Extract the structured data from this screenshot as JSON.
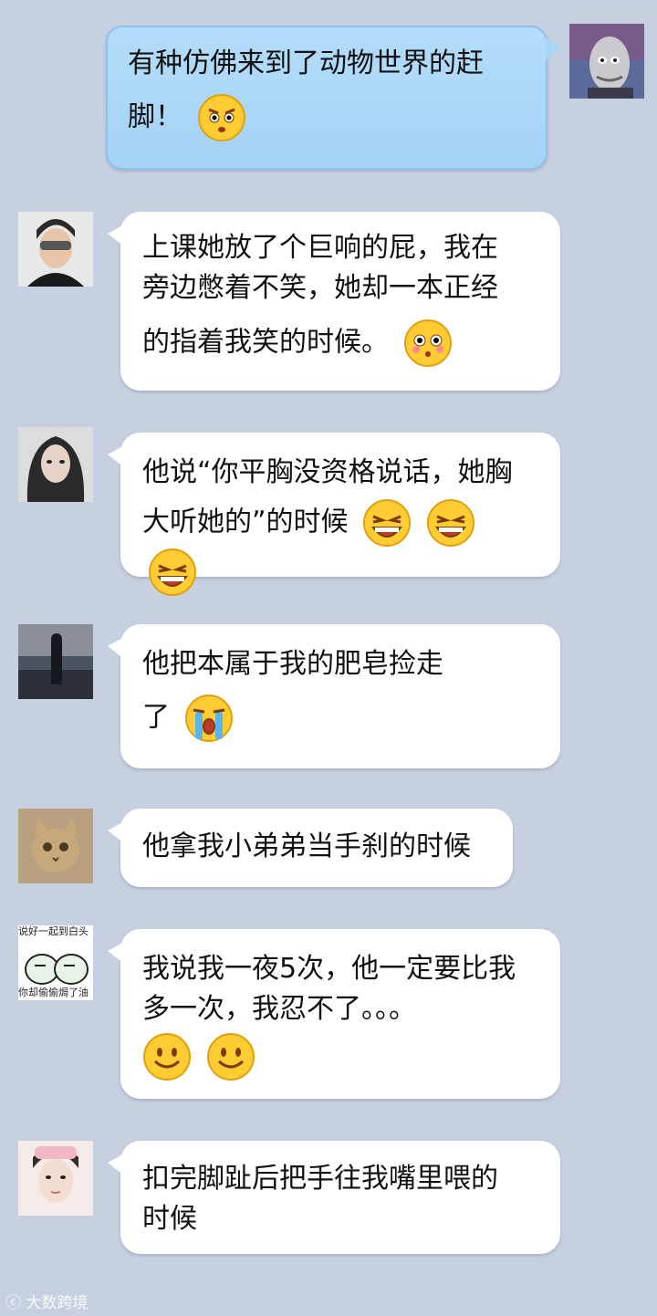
{
  "messages": [
    {
      "side": "out",
      "lines": [
        "有种仿佛来到了动物世界的赶",
        "脚！"
      ],
      "emoji": [
        "angry-face"
      ]
    },
    {
      "side": "in",
      "lines": [
        "上课她放了个巨响的屁，我在",
        "旁边憋着不笑，她却一本正经",
        "的指着我笑的时候。"
      ],
      "emoji": [
        "shocked-face"
      ]
    },
    {
      "side": "in",
      "lines": [
        "他说“你平胸没资格说话，她胸",
        "大听她的”的时候"
      ],
      "emoji": [
        "laughing-face",
        "laughing-face",
        "laughing-face"
      ]
    },
    {
      "side": "in",
      "lines": [
        "他把本属于我的肥皂捡走",
        "了"
      ],
      "emoji": [
        "crying-face"
      ]
    },
    {
      "side": "in",
      "lines": [
        "他拿我小弟弟当手刹的时候"
      ],
      "emoji": []
    },
    {
      "side": "in",
      "lines": [
        "我说我一夜5次，他一定要比我",
        "多一次，我忍不了。。。"
      ],
      "emoji": [
        "smile-face",
        "smile-face"
      ]
    },
    {
      "side": "in",
      "lines": [
        "扣完脚趾后把手往我嘴里喂的",
        "时候"
      ],
      "emoji": []
    }
  ],
  "avatar_texts": {
    "top": "说好一起到白头",
    "bottom": "你却偷偷焗了油"
  },
  "watermark": "大数跨境",
  "colors": {
    "background": "#c6d0e0",
    "out_bubble": "#a9d6f7",
    "in_bubble": "#ffffff"
  }
}
